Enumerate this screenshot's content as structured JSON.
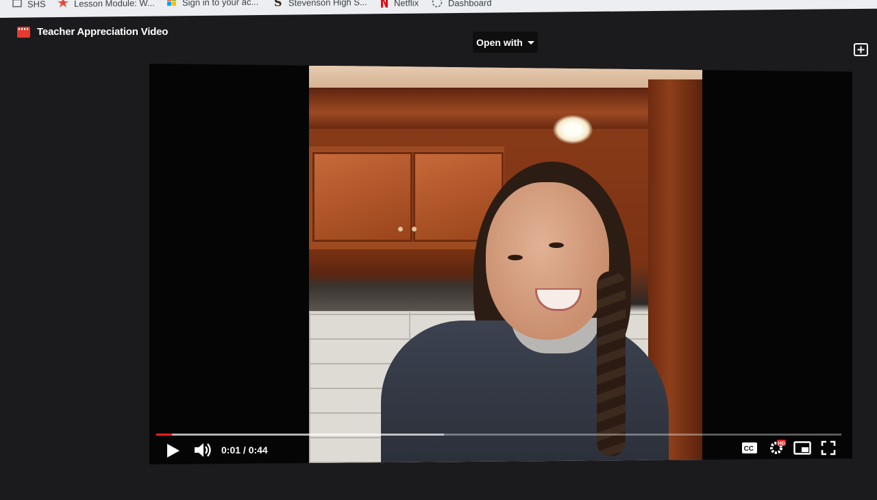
{
  "bookmarks": [
    {
      "label": "SHS",
      "icon": "page-icon"
    },
    {
      "label": "Lesson Module: W...",
      "icon": "star-icon",
      "color": "#e5463b"
    },
    {
      "label": "Sign in to your ac...",
      "icon": "microsoft-icon"
    },
    {
      "label": "Stevenson High S...",
      "icon": "s-logo-icon"
    },
    {
      "label": "Netflix",
      "icon": "netflix-icon",
      "color": "#e50914"
    },
    {
      "label": "Dashboard",
      "icon": "dashboard-icon"
    }
  ],
  "viewer": {
    "title": "Teacher Appreciation Video",
    "open_with_label": "Open with"
  },
  "player": {
    "current_time": "0:01",
    "duration": "0:44",
    "time_display": "0:01 / 0:44",
    "played_fraction": 0.023,
    "loaded_fraction": 0.42,
    "captions_label": "CC",
    "hd_badge": "HD",
    "accent_color": "#ff1f1f"
  }
}
